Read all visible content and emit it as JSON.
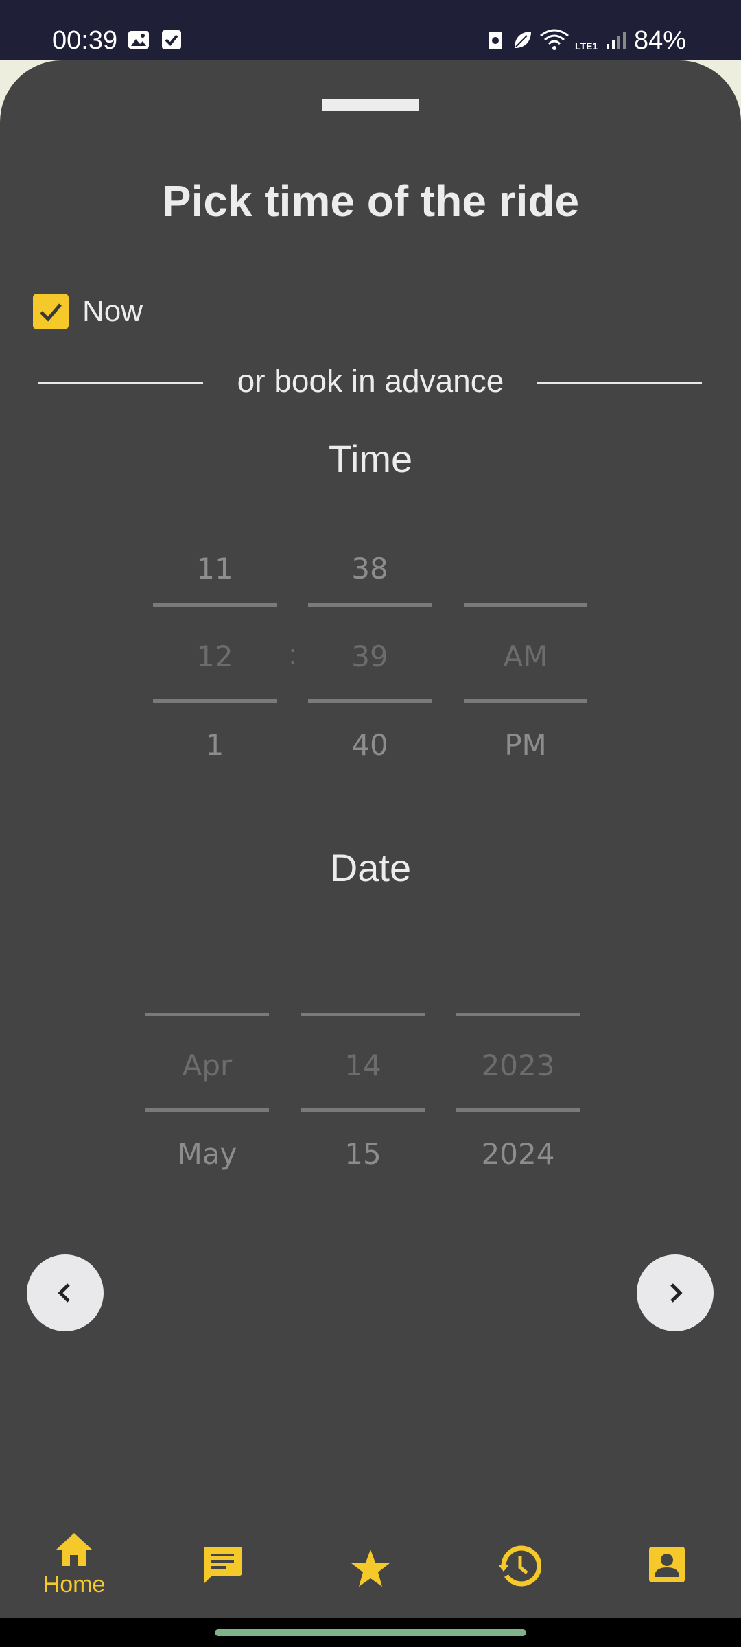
{
  "status_bar": {
    "time": "00:39",
    "battery": "84%",
    "network": "LTE1"
  },
  "sheet": {
    "title": "Pick time of the ride",
    "now_label": "Now",
    "now_checked": true,
    "divider_text": "or book in advance"
  },
  "time_picker": {
    "heading": "Time",
    "hours": [
      "11",
      "12",
      "1"
    ],
    "separator": ":",
    "minutes": [
      "38",
      "39",
      "40"
    ],
    "periods": [
      "",
      "AM",
      "PM"
    ]
  },
  "date_picker": {
    "heading": "Date",
    "months": [
      "",
      "Apr",
      "May"
    ],
    "days": [
      "",
      "14",
      "15"
    ],
    "years": [
      "",
      "2023",
      "2024"
    ]
  },
  "navigation": {
    "items": [
      {
        "label": "Home",
        "icon": "home-icon",
        "active": true
      },
      {
        "label": "",
        "icon": "chat-icon",
        "active": false
      },
      {
        "label": "",
        "icon": "star-icon",
        "active": false
      },
      {
        "label": "",
        "icon": "history-icon",
        "active": false
      },
      {
        "label": "",
        "icon": "account-icon",
        "active": false
      }
    ]
  },
  "colors": {
    "accent": "#f5c92a",
    "sheet": "#444444",
    "status_bar": "#1f2038"
  }
}
